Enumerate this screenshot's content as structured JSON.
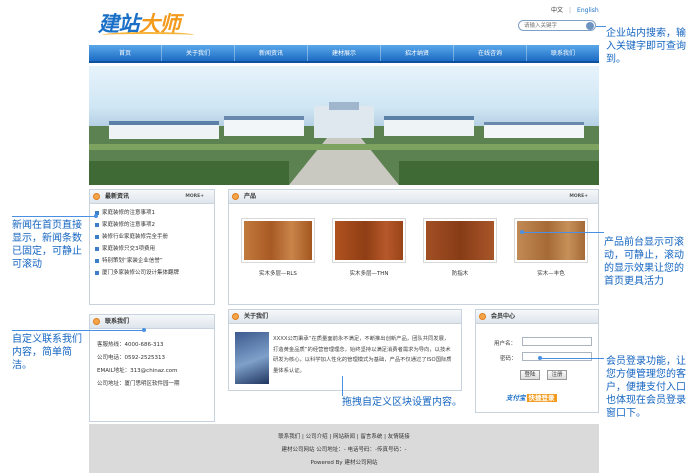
{
  "header": {
    "logo_text_blue": "建站",
    "logo_text_orange": "大师",
    "lang_zh": "中文",
    "lang_sep": "|",
    "lang_en": "English",
    "search_placeholder": "请输入关键字"
  },
  "nav": {
    "items": [
      "首页",
      "关于我们",
      "新闻资讯",
      "建材展示",
      "招才纳贤",
      "在线咨询",
      "联系我们"
    ]
  },
  "news": {
    "title": "最新资讯",
    "more": "MORE+",
    "items": [
      "家庭装修的注意事项1",
      "家庭装修的注意事项2",
      "装修行业家庭装修完全手册",
      "家庭装修只交3项费用",
      "特别策划“家装企业信誉”",
      "厦门多家装修公司设计集体翻牌"
    ]
  },
  "products": {
    "title": "产品",
    "more": "MORE+",
    "items": [
      {
        "name": "实木多层—RLS",
        "color": "#b8692d"
      },
      {
        "name": "实木多层—THN",
        "color": "#a5481e"
      },
      {
        "name": "防指木",
        "color": "#9b4a22"
      },
      {
        "name": "实木—丰色",
        "color": "#b87a45"
      }
    ]
  },
  "contact": {
    "title": "联系我们",
    "lines": [
      "客服热线：4000-686-313",
      "公司电话：0592-2525313",
      "EMAIL地址：313@chinaz.com",
      "公司地址：厦门思明区软件园一期"
    ]
  },
  "about": {
    "title": "关于我们",
    "text": "XXXX公司秉承“在质量面前永不满足，不断推出创新产品，团队共同发展，打造黄金品质”的经营管理理念，始终坚持以满足消费者需求为导向，以技术研发为核心，以科学加人性化的管理模式为基础，产品不仅通过了ISO国际质量体系认证。"
  },
  "member": {
    "title": "会员中心",
    "username_label": "用户名：",
    "password_label": "密码：",
    "login_btn": "登陆",
    "register_btn": "注册",
    "alipay_a": "支付宝",
    "alipay_b": "快捷登录"
  },
  "footer": {
    "links": "联系我们 | 公司介绍 | 网站新闻 | 留言系统 | 友情链接",
    "info": "建材公司网站  公司地址：-  电话号码：-传真号码：-",
    "powered": "Powered By 建材公司网站"
  },
  "annotations": {
    "search": "企业站内搜索，输入关键字即可查询到。",
    "news": "新闻在首页直接显示，新闻条数已固定，可静止可滚动",
    "product": "产品前台显示可滚动，可静止，滚动的显示效果让您的首页更具活力",
    "contact": "自定义联系我们内容，简单简洁。",
    "about": "拖拽自定义区块设置内容。",
    "member": "会员登录功能，让您方便管理您的客户，便捷支付入口也体现在会员登录窗口下。"
  }
}
